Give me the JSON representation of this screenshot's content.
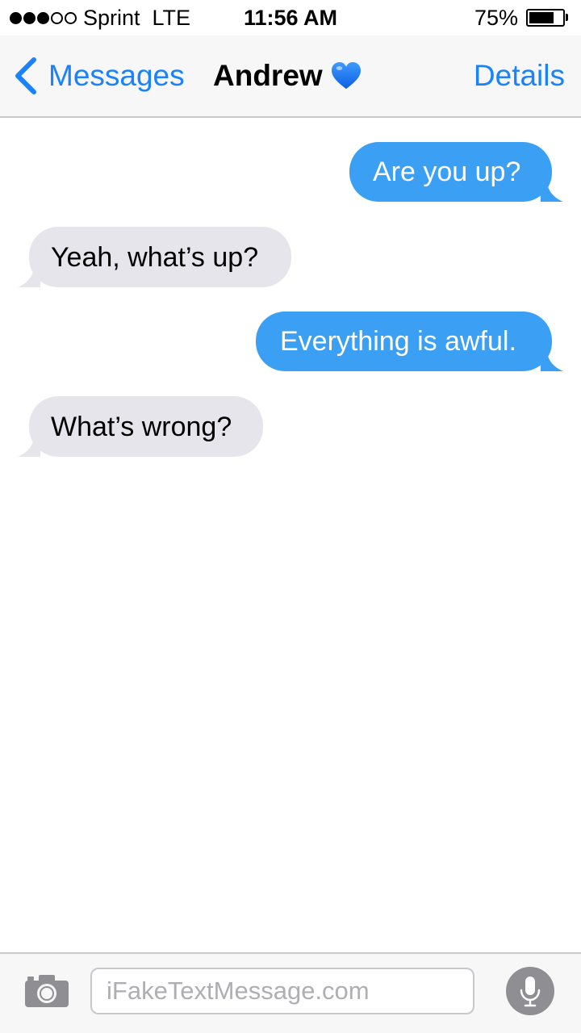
{
  "status_bar": {
    "signal_strength": "3 of 5",
    "carrier": "Sprint  LTE",
    "time": "11:56 AM",
    "battery_percent": "75%",
    "battery_level": 0.75
  },
  "nav": {
    "back_label": "Messages",
    "contact_name": "Andrew",
    "title_emoji": "blue-heart-icon",
    "details_label": "Details",
    "accent_color": "#1a82fb"
  },
  "messages": [
    {
      "direction": "outgoing",
      "text": "Are you up?"
    },
    {
      "direction": "incoming",
      "text": "Yeah, what’s up?"
    },
    {
      "direction": "outgoing",
      "text": "Everything is awful."
    },
    {
      "direction": "incoming",
      "text": "What’s wrong?"
    }
  ],
  "input_bar": {
    "placeholder": "iFakeTextMessage.com",
    "camera_icon": "camera-icon",
    "mic_icon": "microphone-icon"
  },
  "colors": {
    "outgoing_bubble": "#3b9ff4",
    "incoming_bubble": "#e6e5eb",
    "bar_background": "#f7f7f7"
  }
}
